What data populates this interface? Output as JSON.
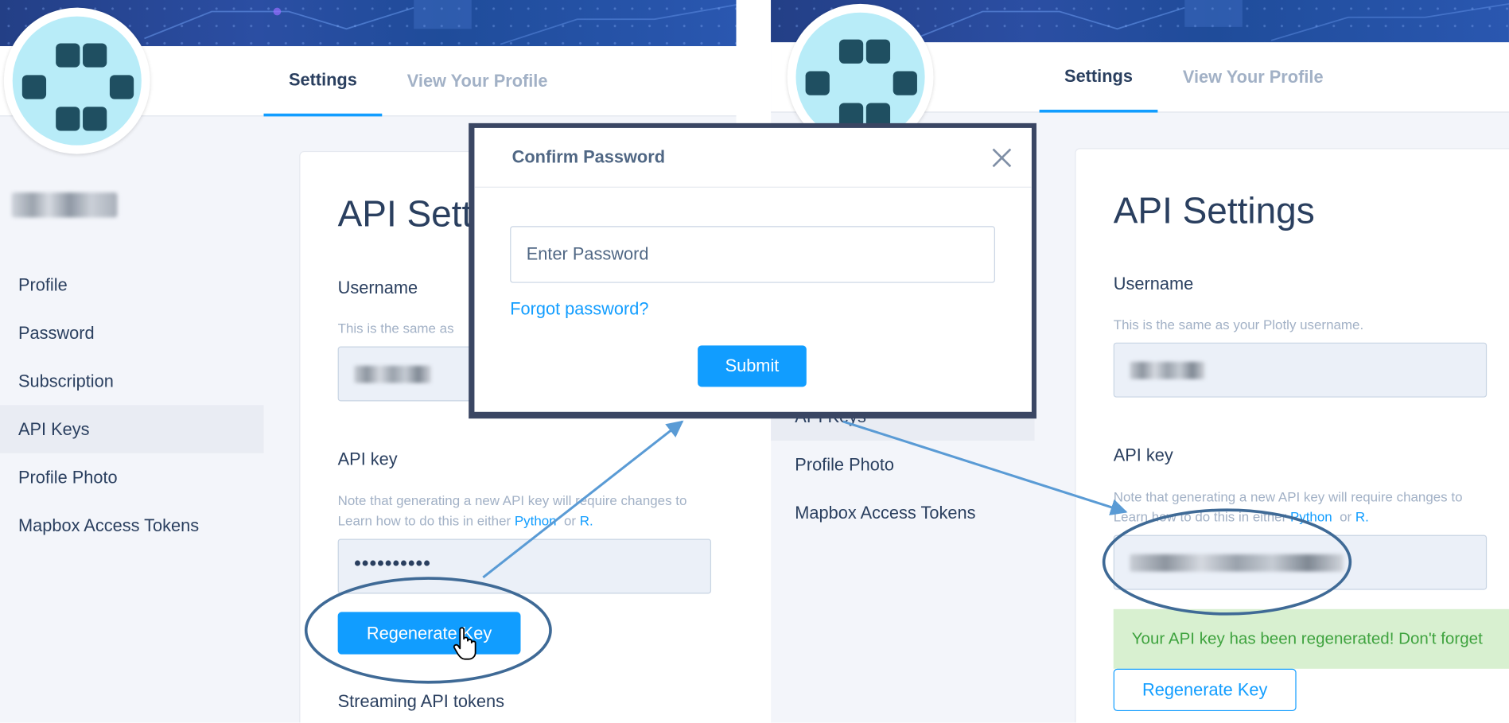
{
  "left": {
    "tabs": [
      {
        "label": "Settings"
      },
      {
        "label": "View Your Profile"
      }
    ],
    "sidebar": [
      {
        "label": "Profile"
      },
      {
        "label": "Password"
      },
      {
        "label": "Subscription"
      },
      {
        "label": "API Keys"
      },
      {
        "label": "Profile Photo"
      },
      {
        "label": "Mapbox Access Tokens"
      }
    ],
    "card": {
      "title": "API Setti",
      "username_label": "Username",
      "username_note": "This is the same as",
      "apikey_label": "API key",
      "apikey_note_1": "Note that generating a new API key will require changes to",
      "apikey_note_2": "Learn how to do this in either",
      "python_link": "Python",
      "or_text": "or",
      "r_link": "R.",
      "apikey_value": "••••••••••",
      "regenerate_label": "Regenerate Key",
      "streaming_label": "Streaming API tokens"
    }
  },
  "modal": {
    "title": "Confirm Password",
    "password_placeholder": "Enter Password",
    "forgot_label": "Forgot password?",
    "submit_label": "Submit"
  },
  "right": {
    "tabs": [
      {
        "label": "Settings"
      },
      {
        "label": "View Your Profile"
      }
    ],
    "sidebar": [
      {
        "label": "API Keys"
      },
      {
        "label": "Profile Photo"
      },
      {
        "label": "Mapbox Access Tokens"
      }
    ],
    "card": {
      "title": "API Settings",
      "username_label": "Username",
      "username_note": "This is the same as your Plotly username.",
      "apikey_label": "API key",
      "apikey_note_1": "Note that generating a new API key will require changes to",
      "apikey_note_2": "Learn how to do this in either",
      "python_link": "Python",
      "or_text": "or",
      "r_link": "R.",
      "success_message": "Your API key has been regenerated! Don't forget",
      "regenerate_label": "Regenerate Key"
    }
  },
  "colors": {
    "accent": "#119dff",
    "text": "#2a3f5f",
    "muted": "#a2b1c6",
    "annotation": "#3f6a96"
  },
  "icons": [
    "close-icon",
    "hand-cursor-icon",
    "avatar-logo-icon"
  ]
}
